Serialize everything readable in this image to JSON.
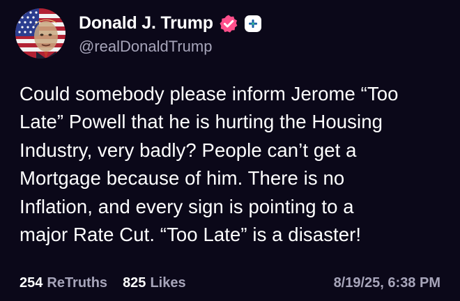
{
  "author": {
    "display_name": "Donald J. Trump",
    "handle": "@realDonaldTrump"
  },
  "post": {
    "text": "Could somebody please inform Jerome “Too\nLate” Powell that he is hurting the Housing\nIndustry, very badly? People can’t get a\nMortgage because of him. There is no\nInflation, and every sign is pointing to a\nmajor Rate Cut. “Too Late” is a disaster!"
  },
  "stats": {
    "retruths_count": "254",
    "retruths_label": "ReTruths",
    "likes_count": "825",
    "likes_label": "Likes",
    "timestamp": "8/19/25, 6:38 PM"
  },
  "colors": {
    "background": "#0b0819",
    "verified_badge": "#ff4f8b",
    "muted_text": "#a7a5ba"
  },
  "icons": {
    "verified": "verified-badge-icon",
    "follow": "plus-icon"
  }
}
